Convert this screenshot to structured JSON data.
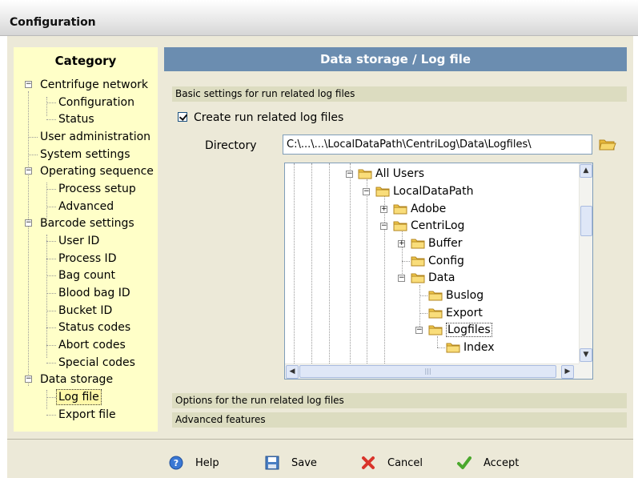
{
  "window": {
    "title": "Configuration"
  },
  "sidebar": {
    "header": "Category",
    "items": [
      {
        "label": "Centrifuge network"
      },
      {
        "label": "Configuration"
      },
      {
        "label": "Status"
      },
      {
        "label": "User administration"
      },
      {
        "label": "System settings"
      },
      {
        "label": "Operating sequence"
      },
      {
        "label": "Process setup"
      },
      {
        "label": "Advanced"
      },
      {
        "label": "Barcode settings"
      },
      {
        "label": "User ID"
      },
      {
        "label": "Process ID"
      },
      {
        "label": "Bag count"
      },
      {
        "label": "Blood bag ID"
      },
      {
        "label": "Bucket ID"
      },
      {
        "label": "Status codes"
      },
      {
        "label": "Abort codes"
      },
      {
        "label": "Special codes"
      },
      {
        "label": "Data storage"
      },
      {
        "label": "Log file"
      },
      {
        "label": "Export file"
      }
    ],
    "selected": "Log file"
  },
  "main": {
    "header": "Data storage / Log file",
    "section_basic": "Basic settings for run related log files",
    "checkbox_label": "Create run related log files",
    "checkbox_checked": true,
    "directory_label": "Directory",
    "directory_value": "C:\\...\\...\\LocalDataPath\\CentriLog\\Data\\Logfiles\\",
    "section_options": "Options for the run related log files",
    "section_advanced": "Advanced features"
  },
  "folder_tree": {
    "nodes": [
      {
        "label": "All Users"
      },
      {
        "label": "LocalDataPath"
      },
      {
        "label": "Adobe"
      },
      {
        "label": "CentriLog"
      },
      {
        "label": "Buffer"
      },
      {
        "label": "Config"
      },
      {
        "label": "Data"
      },
      {
        "label": "Buslog"
      },
      {
        "label": "Export"
      },
      {
        "label": "Logfiles"
      },
      {
        "label": "Index"
      }
    ],
    "selected": "Logfiles"
  },
  "footer": {
    "help": "Help",
    "save": "Save",
    "cancel": "Cancel",
    "accept": "Accept"
  },
  "icons": {
    "folder": "folder-icon",
    "help": "help-icon",
    "save": "save-icon",
    "cancel": "cancel-icon",
    "accept": "accept-icon"
  },
  "colors": {
    "sidebar_bg": "#ffffc8",
    "header_bg": "#6b8db0",
    "section_bg": "#dcdcc0",
    "folder": "#f2c94c"
  }
}
